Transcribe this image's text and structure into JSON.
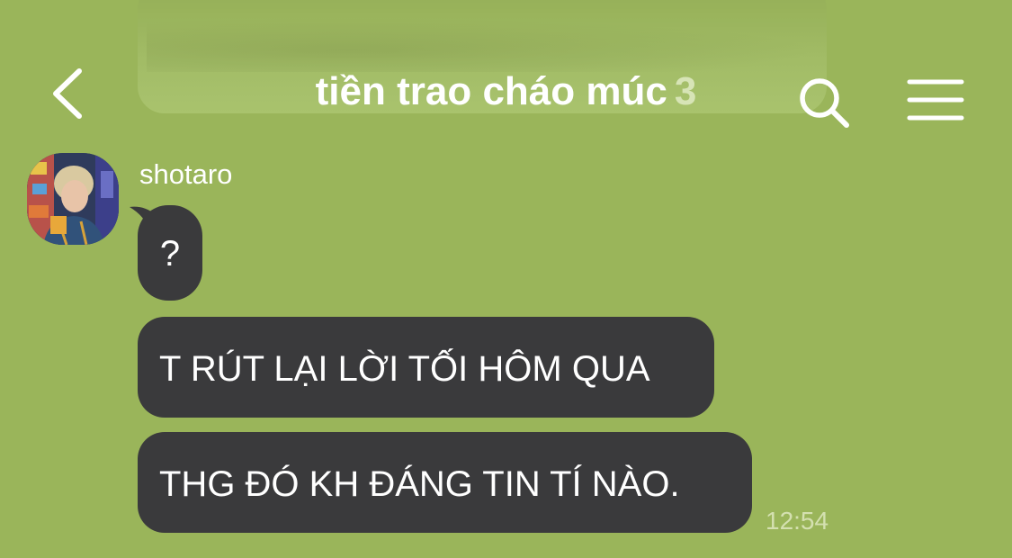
{
  "header": {
    "title": "tiền trao cháo múc",
    "member_count": "3"
  },
  "icons": {
    "back": "chevron-left-icon",
    "search": "search-icon",
    "menu": "hamburger-menu-icon"
  },
  "message_group": {
    "sender_name": "shotaro",
    "messages": [
      {
        "text": "?"
      },
      {
        "text": "T RÚT LẠI LỜI TỐI HÔM QUA"
      },
      {
        "text": "THG ĐÓ KH ĐÁNG TIN TÍ NÀO."
      }
    ],
    "time": "12:54"
  },
  "colors": {
    "background": "#9ab55a",
    "bubble": "#3a3a3c",
    "text": "#ffffff"
  }
}
